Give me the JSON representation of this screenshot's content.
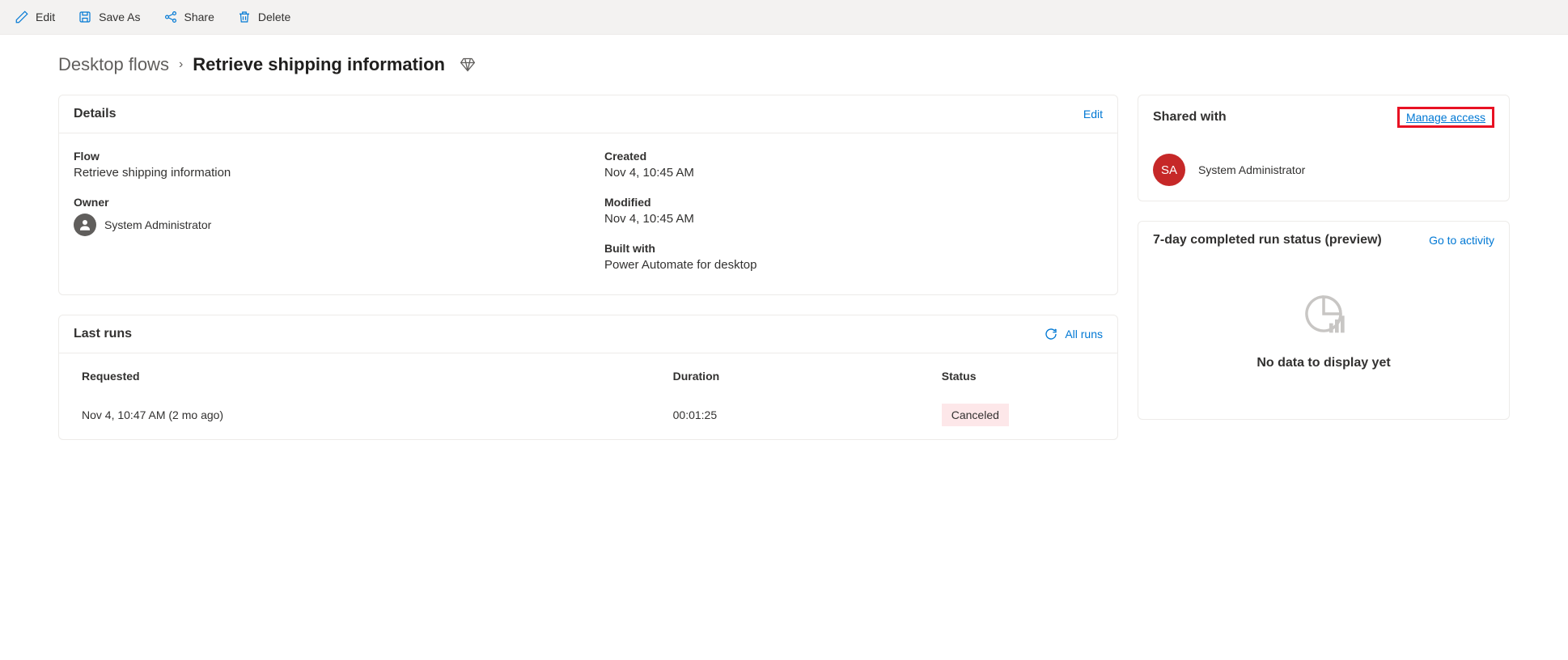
{
  "toolbar": {
    "edit": "Edit",
    "save_as": "Save As",
    "share": "Share",
    "delete": "Delete"
  },
  "breadcrumb": {
    "parent": "Desktop flows",
    "current": "Retrieve shipping information"
  },
  "details": {
    "title": "Details",
    "edit_link": "Edit",
    "flow_label": "Flow",
    "flow_value": "Retrieve shipping information",
    "owner_label": "Owner",
    "owner_value": "System Administrator",
    "created_label": "Created",
    "created_value": "Nov 4, 10:45 AM",
    "modified_label": "Modified",
    "modified_value": "Nov 4, 10:45 AM",
    "built_label": "Built with",
    "built_value": "Power Automate for desktop"
  },
  "runs": {
    "title": "Last runs",
    "all_runs": "All runs",
    "headers": {
      "requested": "Requested",
      "duration": "Duration",
      "status": "Status"
    },
    "row": {
      "requested": "Nov 4, 10:47 AM (2 mo ago)",
      "duration": "00:01:25",
      "status": "Canceled"
    }
  },
  "shared": {
    "title": "Shared with",
    "manage": "Manage access",
    "user_initials": "SA",
    "user_name": "System Administrator"
  },
  "runstatus": {
    "title": "7-day completed run status (preview)",
    "activity_link": "Go to activity",
    "empty": "No data to display yet"
  }
}
